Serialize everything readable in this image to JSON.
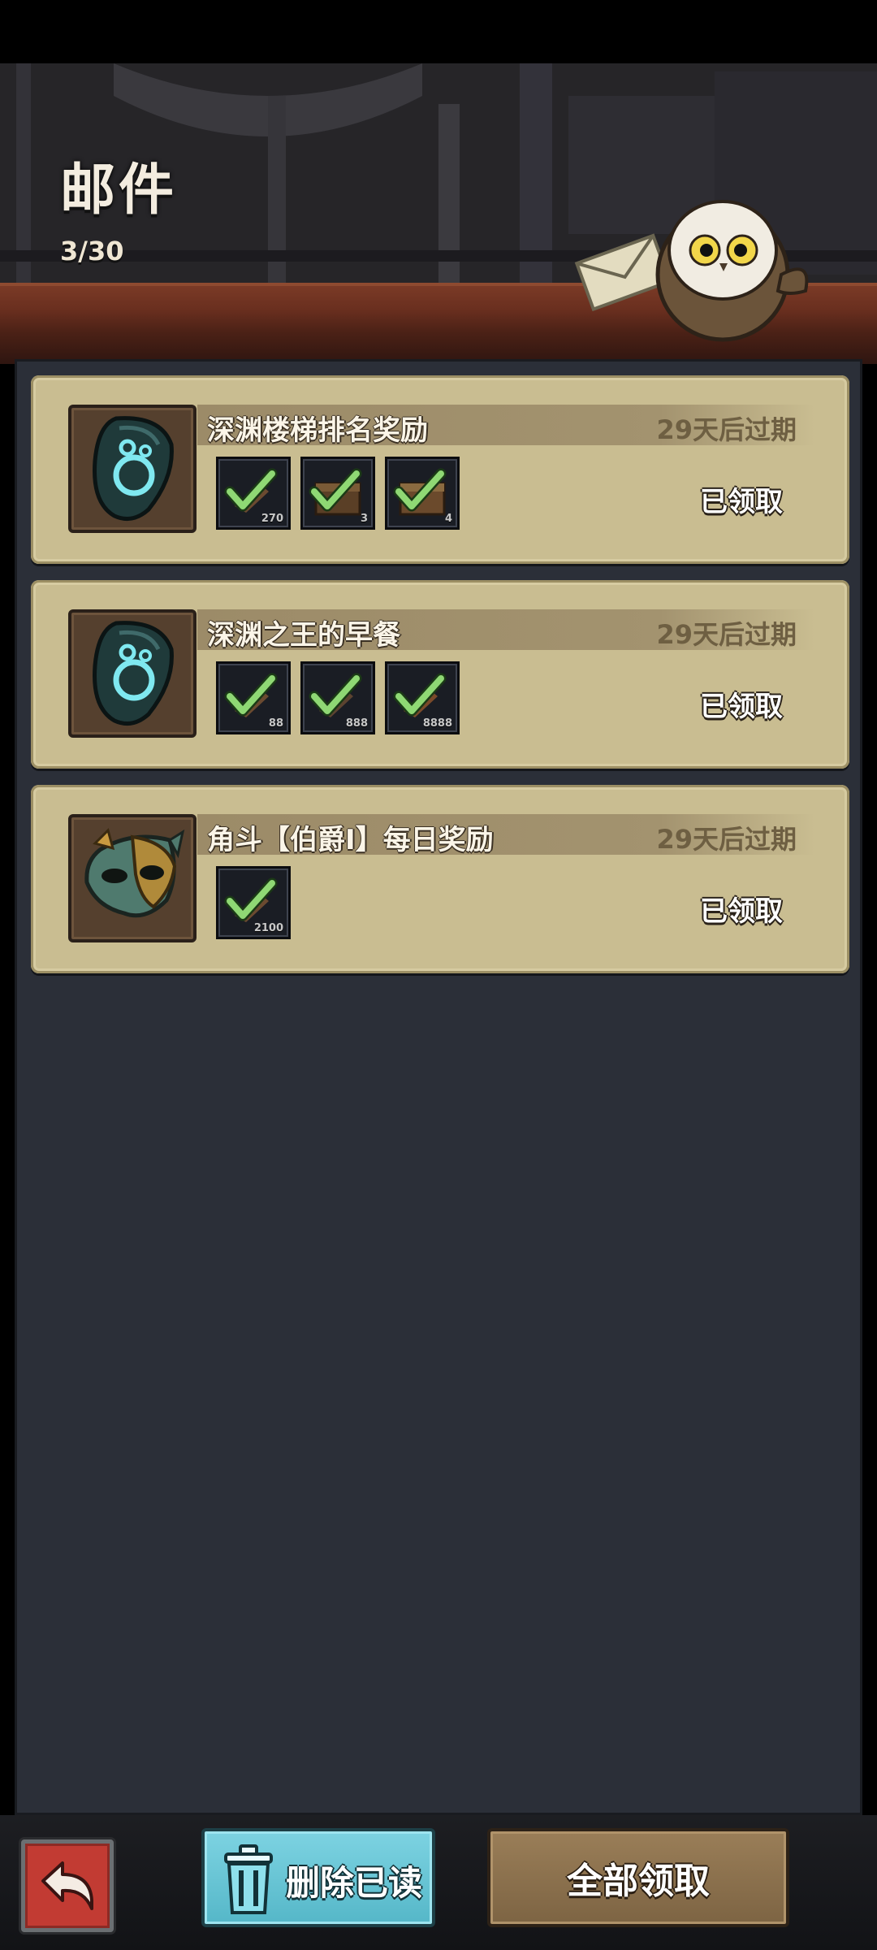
{
  "header": {
    "title": "邮件",
    "mail_count": "3/30"
  },
  "mails": [
    {
      "title": "深渊楼梯排名奖励",
      "expiry": "29天后过期",
      "status": "已领取",
      "icon": "dark-crystal-icon",
      "rewards": [
        {
          "icon": "claimed-item-icon",
          "qty": "270"
        },
        {
          "icon": "claimed-chest-icon",
          "qty": "3"
        },
        {
          "icon": "claimed-chest-icon",
          "qty": "4"
        }
      ]
    },
    {
      "title": "深渊之王的早餐",
      "expiry": "29天后过期",
      "status": "已领取",
      "icon": "dark-crystal-icon",
      "rewards": [
        {
          "icon": "claimed-item-icon",
          "qty": "88"
        },
        {
          "icon": "claimed-item-icon",
          "qty": "888"
        },
        {
          "icon": "claimed-item-icon",
          "qty": "8888"
        }
      ]
    },
    {
      "title": "角斗【伯爵I】每日奖励",
      "expiry": "29天后过期",
      "status": "已领取",
      "icon": "masquerade-mask-icon",
      "rewards": [
        {
          "icon": "claimed-item-icon",
          "qty": "2100"
        }
      ]
    }
  ],
  "footer": {
    "back_icon": "back-arrow-icon",
    "delete_read_label": "删除已读",
    "claim_all_label": "全部领取"
  },
  "colors": {
    "card": "#c9bd91",
    "panel": "#2b2f38",
    "delete_button": "#6cc8d8",
    "claim_button": "#8c7150",
    "back_button": "#c23b33"
  }
}
